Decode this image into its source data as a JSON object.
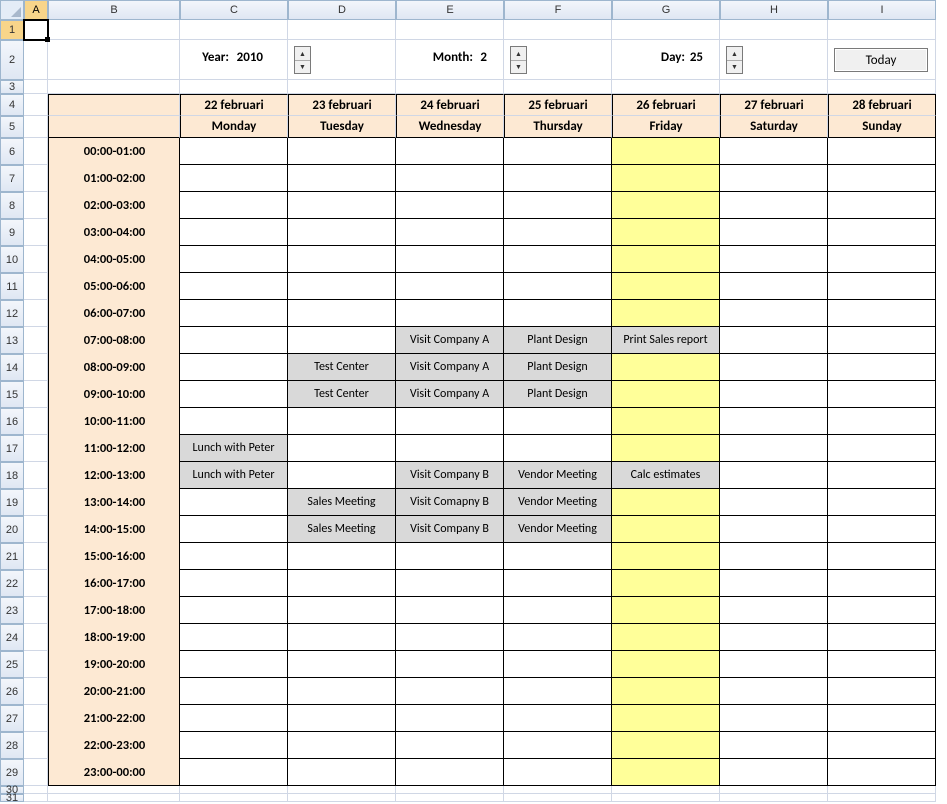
{
  "columns": [
    "A",
    "B",
    "C",
    "D",
    "E",
    "F",
    "G",
    "H",
    "I"
  ],
  "selected_col_index": 0,
  "row_labels": [
    1,
    2,
    3,
    4,
    5,
    6,
    7,
    8,
    9,
    10,
    11,
    12,
    13,
    14,
    15,
    16,
    17,
    18,
    19,
    20,
    21,
    22,
    23,
    24,
    25,
    26,
    27,
    28,
    29,
    30,
    31
  ],
  "selected_row": 1,
  "controls": {
    "year_label": "Year:",
    "year_value": "2010",
    "month_label": "Month:",
    "month_value": "2",
    "day_label": "Day:",
    "day_value": "25",
    "today_label": "Today"
  },
  "days": [
    {
      "date": "22 februari",
      "dow": "Monday"
    },
    {
      "date": "23 februari",
      "dow": "Tuesday"
    },
    {
      "date": "24 februari",
      "dow": "Wednesday"
    },
    {
      "date": "25 februari",
      "dow": "Thursday"
    },
    {
      "date": "26 februari",
      "dow": "Friday"
    },
    {
      "date": "27 februari",
      "dow": "Saturday"
    },
    {
      "date": "28 februari",
      "dow": "Sunday"
    }
  ],
  "highlight_day_index": 4,
  "times": [
    "00:00-01:00",
    "01:00-02:00",
    "02:00-03:00",
    "03:00-04:00",
    "04:00-05:00",
    "05:00-06:00",
    "06:00-07:00",
    "07:00-08:00",
    "08:00-09:00",
    "09:00-10:00",
    "10:00-11:00",
    "11:00-12:00",
    "12:00-13:00",
    "13:00-14:00",
    "14:00-15:00",
    "15:00-16:00",
    "16:00-17:00",
    "17:00-18:00",
    "18:00-19:00",
    "19:00-20:00",
    "20:00-21:00",
    "21:00-22:00",
    "22:00-23:00",
    "23:00-00:00"
  ],
  "events": {
    "7": {
      "2": "Visit Company A",
      "3": "Plant Design",
      "4": "Print Sales report"
    },
    "8": {
      "1": "Test Center",
      "2": "Visit Company A",
      "3": "Plant Design"
    },
    "9": {
      "1": "Test Center",
      "2": "Visit Company A",
      "3": "Plant Design"
    },
    "11": {
      "0": "Lunch with Peter"
    },
    "12": {
      "0": "Lunch with Peter",
      "2": "Visit Company B",
      "3": "Vendor Meeting",
      "4": "Calc estimates"
    },
    "13": {
      "1": "Sales Meeting",
      "2": "Visit Comapny B",
      "3": "Vendor Meeting"
    },
    "14": {
      "1": "Sales Meeting",
      "2": "Visit Company B",
      "3": "Vendor Meeting"
    }
  }
}
